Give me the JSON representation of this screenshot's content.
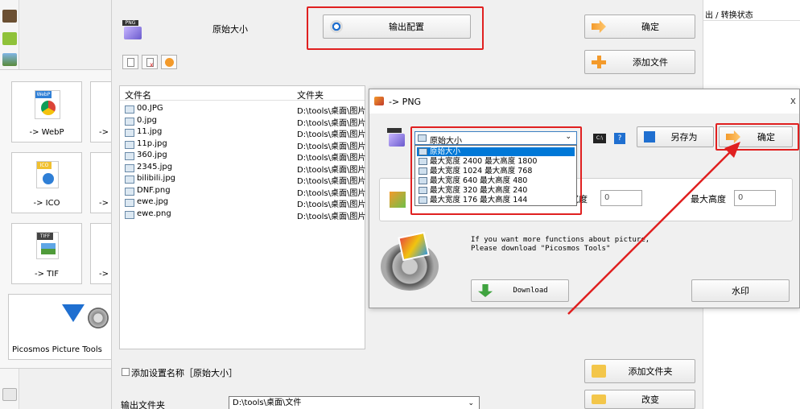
{
  "main": {
    "format_name": "原始大小",
    "output_config_button": "输出配置",
    "ok_button": "确定",
    "add_file_button": "添加文件",
    "add_folder_button": "添加文件夹",
    "change_button": "改变",
    "add_setting_name": "添加设置名称［原始大小］",
    "output_folder_label": "输出文件夹",
    "output_folder_value": "D:\\tools\\桌面\\文件",
    "status_header": "出 / 转换状态"
  },
  "filelist": {
    "col_name": "文件名",
    "col_folder": "文件夹",
    "rows": [
      {
        "name": "00.JPG",
        "folder": "D:\\tools\\桌面\\图片"
      },
      {
        "name": "0.jpg",
        "folder": "D:\\tools\\桌面\\图片"
      },
      {
        "name": "11.jpg",
        "folder": "D:\\tools\\桌面\\图片"
      },
      {
        "name": "11p.jpg",
        "folder": "D:\\tools\\桌面\\图片"
      },
      {
        "name": "360.jpg",
        "folder": "D:\\tools\\桌面\\图片"
      },
      {
        "name": "2345.jpg",
        "folder": "D:\\tools\\桌面\\图片"
      },
      {
        "name": "bilibili.jpg",
        "folder": "D:\\tools\\桌面\\图片"
      },
      {
        "name": "DNF.png",
        "folder": "D:\\tools\\桌面\\图片"
      },
      {
        "name": "ewe.jpg",
        "folder": "D:\\tools\\桌面\\图片"
      },
      {
        "name": "ewe.png",
        "folder": "D:\\tools\\桌面\\图片"
      }
    ]
  },
  "tiles": {
    "webp": "-> WebP",
    "ico": "-> ICO",
    "tif": "-> TIF",
    "arrow_partial": "->",
    "picosmos": "Picosmos Picture Tools",
    "webp_badge": "WebP",
    "ico_badge": "ICO",
    "tif_badge": "TIFF"
  },
  "dialog": {
    "title": "-> PNG",
    "close_glyph": "x",
    "combo_value": "原始大小",
    "png_badge": "PNG",
    "save_as_button": "另存为",
    "ok_button": "确定",
    "width_label": "宽度",
    "width_value": "0",
    "height_label": "最大高度",
    "height_value": "0",
    "promo_line1": "If you want more functions about picture,",
    "promo_line2": "Please download \"Picosmos Tools\"",
    "download_button": "Download",
    "watermark_button": "水印",
    "cmd_icon_text": "C:\\",
    "help_icon_text": "?",
    "options": [
      "原始大小",
      "最大宽度 2400 最大高度 1800",
      "最大宽度 1024 最大高度 768",
      "最大宽度 640 最大高度 480",
      "最大宽度 320 最大高度 240",
      "最大宽度 176 最大高度 144"
    ]
  },
  "colors": {
    "highlight_red": "#e02020",
    "selection_blue": "#0078d7",
    "accent_orange": "#f39a2b",
    "green_download": "#3fa33f"
  }
}
